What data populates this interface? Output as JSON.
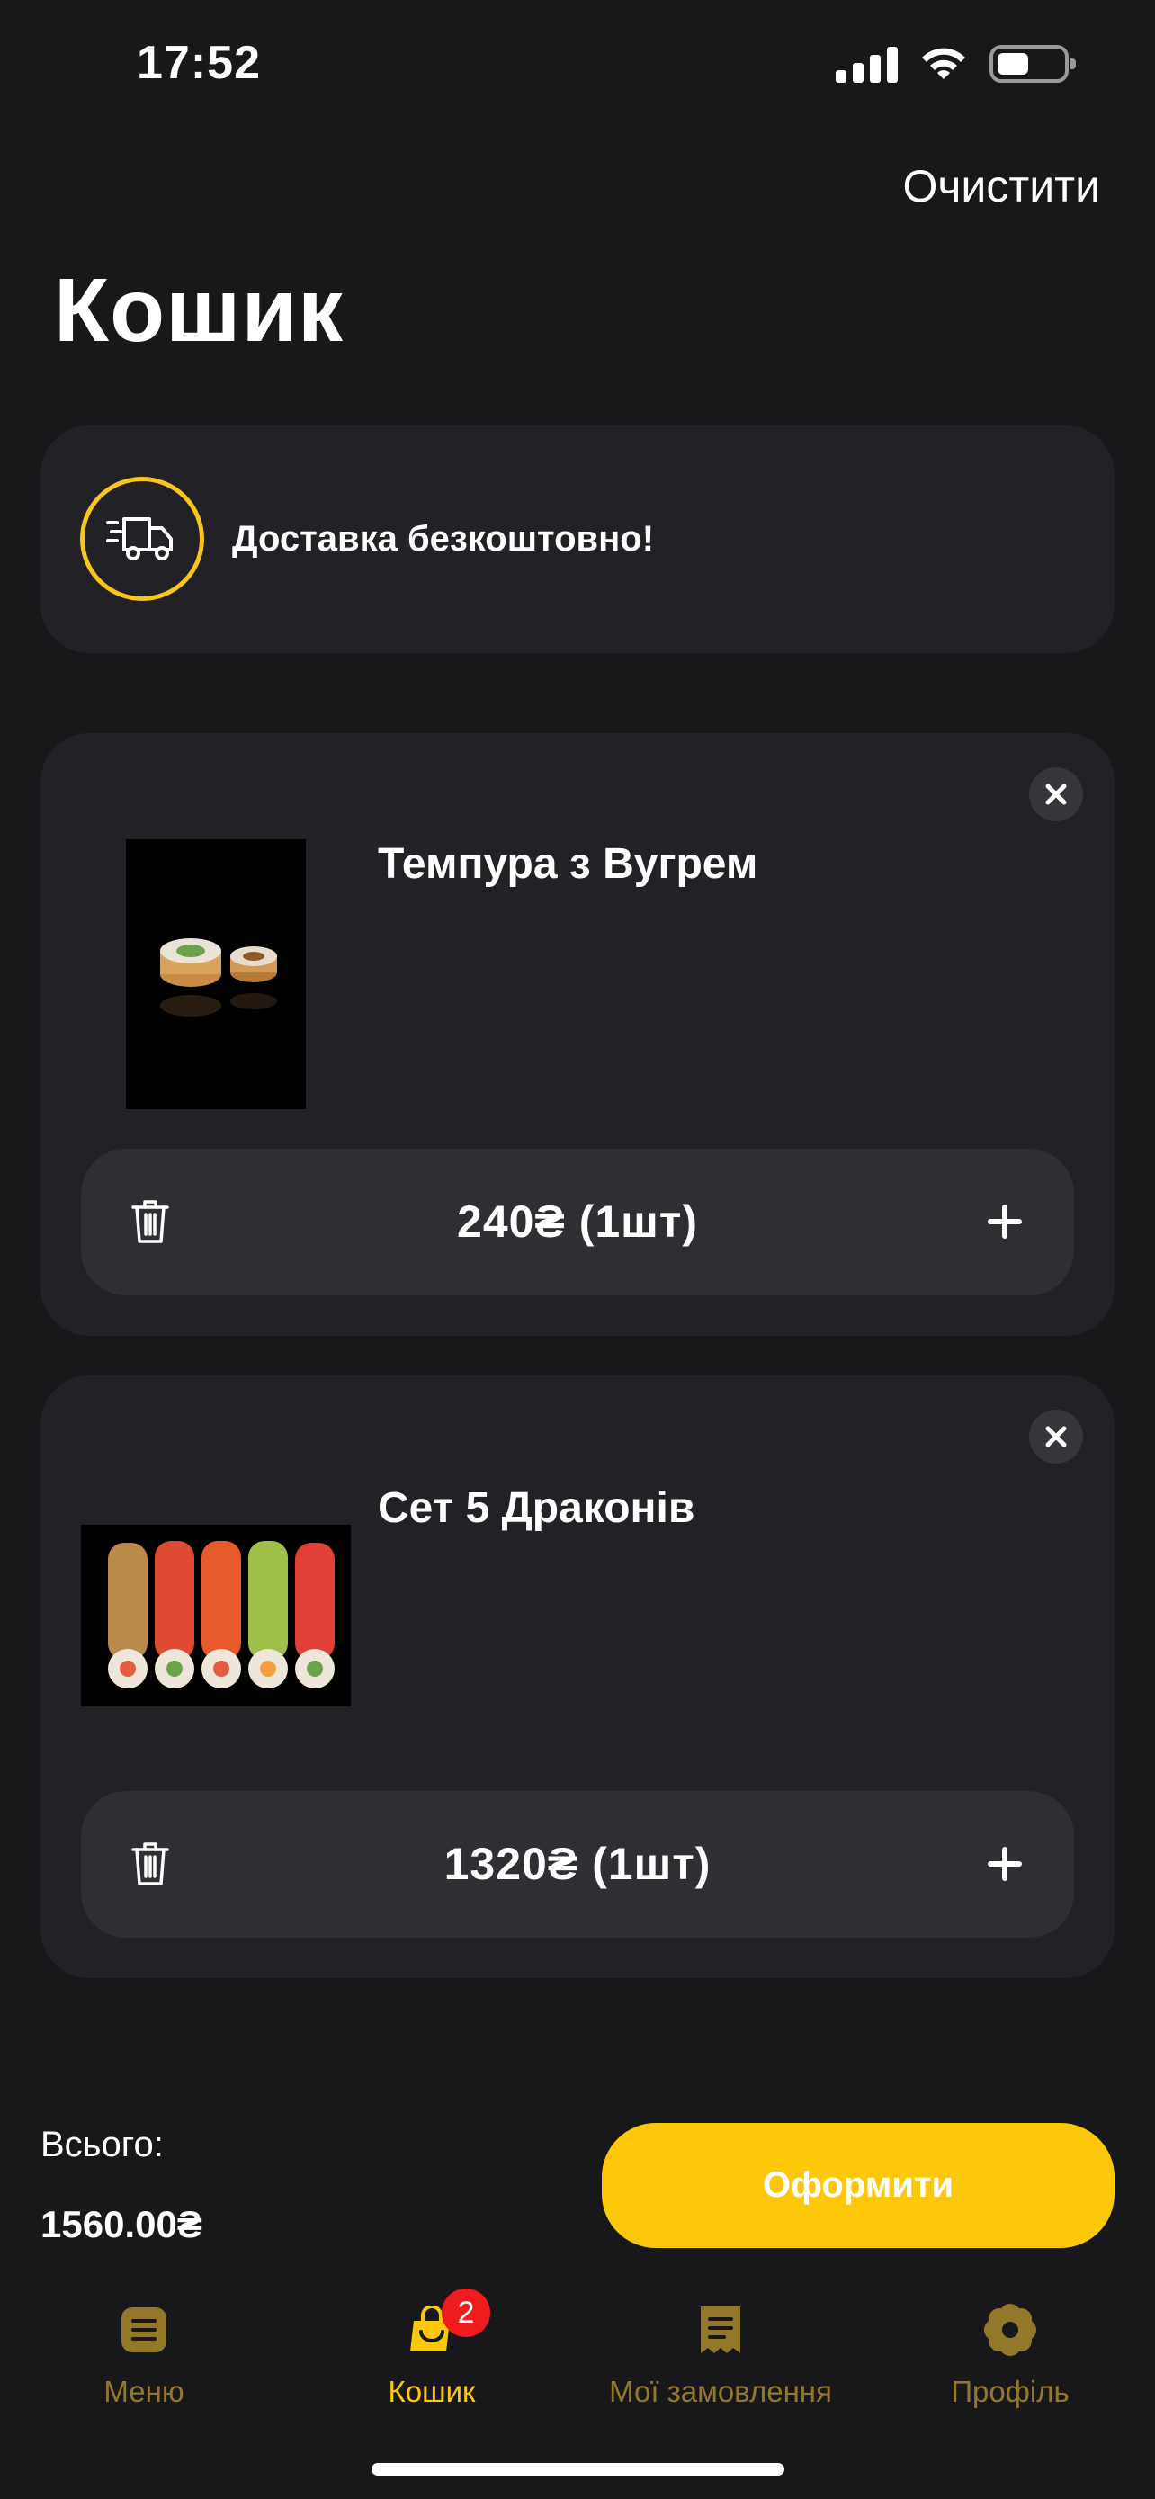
{
  "status_bar": {
    "time": "17:52"
  },
  "header": {
    "clear_label": "Очистити",
    "title": "Кошик"
  },
  "delivery": {
    "text": "Доставка безкоштовно!",
    "icon": "delivery-truck-icon"
  },
  "cart_items": [
    {
      "name": "Темпура з Вугрем",
      "price_text": "240₴",
      "quantity_text": "(1шт)"
    },
    {
      "name": "Сет 5 Драконів",
      "price_text": "1320₴",
      "quantity_text": "(1шт)"
    }
  ],
  "summary": {
    "total_label": "Всього:",
    "total_value": "1560.00₴",
    "checkout_label": "Оформити"
  },
  "tabbar": {
    "items": [
      {
        "label": "Меню",
        "icon": "menu-icon"
      },
      {
        "label": "Кошик",
        "icon": "bag-icon",
        "badge": "2"
      },
      {
        "label": "Мої замовлення",
        "icon": "receipt-icon"
      },
      {
        "label": "Профіль",
        "icon": "flower-icon"
      }
    ],
    "active_index": 1
  },
  "colors": {
    "background": "#18181b",
    "card": "#222226",
    "accent": "#fdc80a",
    "badge": "#ee1c1c"
  }
}
